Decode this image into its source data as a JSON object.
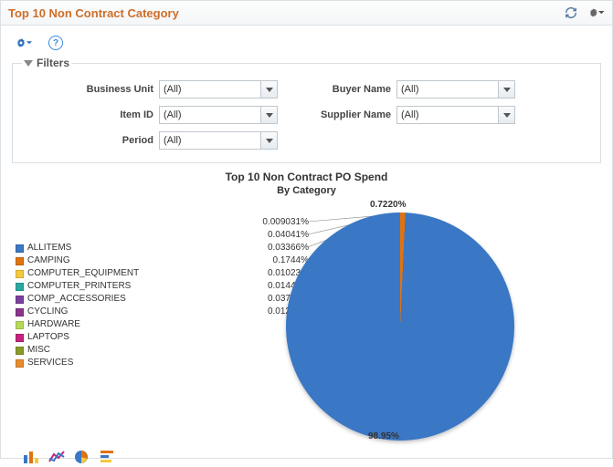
{
  "header": {
    "title": "Top 10 Non Contract Category"
  },
  "filters": {
    "legend": "Filters",
    "rows": {
      "business_unit": {
        "label": "Business Unit",
        "value": "(All)"
      },
      "item_id": {
        "label": "Item ID",
        "value": "(All)"
      },
      "period": {
        "label": "Period",
        "value": "(All)"
      },
      "buyer_name": {
        "label": "Buyer Name",
        "value": "(All)"
      },
      "supplier_name": {
        "label": "Supplier Name",
        "value": "(All)"
      }
    }
  },
  "chart": {
    "title": "Top 10 Non Contract PO Spend",
    "subtitle": "By Category",
    "main_pct": "98.95%",
    "top_pct": "0.7220%",
    "callouts": [
      "0.009031%",
      "0.04041%",
      "0.03366%",
      "0.1744%",
      "0.01023%",
      "0.01443%",
      "0.03776%",
      "0.01293%"
    ],
    "legend": [
      {
        "label": "ALLITEMS",
        "color": "#3a77c4"
      },
      {
        "label": "CAMPING",
        "color": "#e0730f"
      },
      {
        "label": "COMPUTER_EQUIPMENT",
        "color": "#f5c93d"
      },
      {
        "label": "COMPUTER_PRINTERS",
        "color": "#2aa7a0"
      },
      {
        "label": "COMP_ACCESSORIES",
        "color": "#7b3fa0"
      },
      {
        "label": "CYCLING",
        "color": "#8a348a"
      },
      {
        "label": "HARDWARE",
        "color": "#b6d957"
      },
      {
        "label": "LAPTOPS",
        "color": "#c6227e"
      },
      {
        "label": "MISC",
        "color": "#8a9a27"
      },
      {
        "label": "SERVICES",
        "color": "#e88b2d"
      }
    ]
  },
  "chart_data": {
    "type": "pie",
    "title": "Top 10 Non Contract PO Spend",
    "subtitle": "By Category",
    "series": [
      {
        "name": "ALLITEMS",
        "pct": 98.95,
        "color": "#3a77c4"
      },
      {
        "name": "CAMPING",
        "pct": 0.722,
        "color": "#e0730f"
      },
      {
        "name": "COMPUTER_EQUIPMENT",
        "pct": 0.009031,
        "color": "#f5c93d"
      },
      {
        "name": "COMPUTER_PRINTERS",
        "pct": 0.04041,
        "color": "#2aa7a0"
      },
      {
        "name": "COMP_ACCESSORIES",
        "pct": 0.03366,
        "color": "#7b3fa0"
      },
      {
        "name": "CYCLING",
        "pct": 0.1744,
        "color": "#8a348a"
      },
      {
        "name": "HARDWARE",
        "pct": 0.01023,
        "color": "#b6d957"
      },
      {
        "name": "LAPTOPS",
        "pct": 0.01443,
        "color": "#c6227e"
      },
      {
        "name": "MISC",
        "pct": 0.03776,
        "color": "#8a9a27"
      },
      {
        "name": "SERVICES",
        "pct": 0.01293,
        "color": "#e88b2d"
      }
    ]
  }
}
